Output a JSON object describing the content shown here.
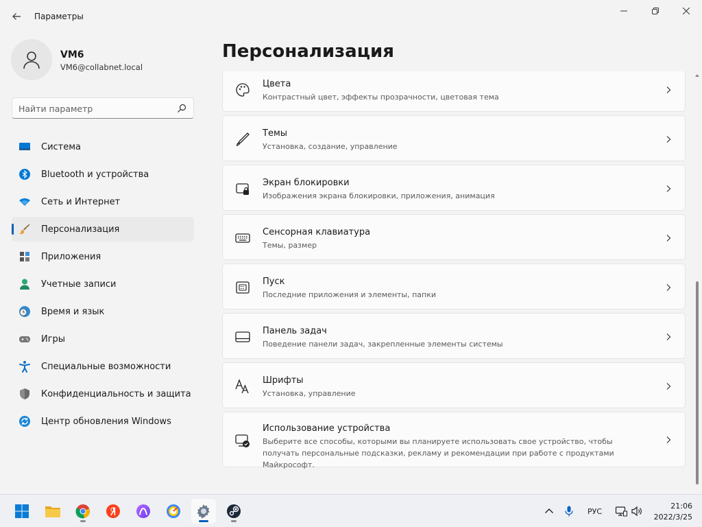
{
  "window": {
    "title": "Параметры",
    "back": "back-arrow-icon",
    "controls": [
      "minimize-icon",
      "maximize-icon",
      "close-icon"
    ]
  },
  "user": {
    "name": "VM6",
    "email": "VM6@collabnet.local"
  },
  "search": {
    "placeholder": "Найти параметр",
    "value": ""
  },
  "sidebar": {
    "items": [
      {
        "label": "Система",
        "icon": "display-icon",
        "active": false
      },
      {
        "label": "Bluetooth и устройства",
        "icon": "bluetooth-icon",
        "active": false
      },
      {
        "label": "Сеть и Интернет",
        "icon": "wifi-icon",
        "active": false
      },
      {
        "label": "Персонализация",
        "icon": "brush-icon",
        "active": true
      },
      {
        "label": "Приложения",
        "icon": "apps-icon",
        "active": false
      },
      {
        "label": "Учетные записи",
        "icon": "person-icon",
        "active": false
      },
      {
        "label": "Время и язык",
        "icon": "globe-clock-icon",
        "active": false
      },
      {
        "label": "Игры",
        "icon": "gamepad-icon",
        "active": false
      },
      {
        "label": "Специальные возможности",
        "icon": "accessibility-icon",
        "active": false
      },
      {
        "label": "Конфиденциальность и защита",
        "icon": "shield-icon",
        "active": false
      },
      {
        "label": "Центр обновления Windows",
        "icon": "update-icon",
        "active": false
      }
    ]
  },
  "page": {
    "title": "Персонализация"
  },
  "cards": [
    {
      "title": "Цвета",
      "subtitle": "Контрастный цвет, эффекты прозрачности, цветовая тема",
      "icon": "palette-icon"
    },
    {
      "title": "Темы",
      "subtitle": "Установка, создание, управление",
      "icon": "pen-icon"
    },
    {
      "title": "Экран блокировки",
      "subtitle": "Изображения экрана блокировки, приложения, анимация",
      "icon": "lock-screen-icon"
    },
    {
      "title": "Сенсорная клавиатура",
      "subtitle": "Темы, размер",
      "icon": "keyboard-icon"
    },
    {
      "title": "Пуск",
      "subtitle": "Последние приложения и элементы, папки",
      "icon": "start-menu-icon"
    },
    {
      "title": "Панель задач",
      "subtitle": "Поведение панели задач, закрепленные элементы системы",
      "icon": "taskbar-icon"
    },
    {
      "title": "Шрифты",
      "subtitle": "Установка, управление",
      "icon": "font-icon"
    },
    {
      "title": "Использование устройства",
      "subtitle": "Выберите все способы, которыми вы планируете использовать свое устройство, чтобы получать персональные подсказки, рекламу и рекомендации при работе с продуктами Майкрософт.",
      "icon": "device-usage-icon"
    }
  ],
  "taskbar": {
    "apps": [
      "windows-start-icon",
      "file-explorer-icon",
      "chrome-icon",
      "yandex-browser-icon",
      "alice-icon",
      "yandex-icon",
      "settings-gear-icon",
      "steam-icon"
    ],
    "active_app": "settings-gear-icon",
    "tray": {
      "language": "РУС",
      "icons": [
        "chevron-up-icon",
        "microphone-icon",
        "network-icon",
        "volume-icon"
      ]
    },
    "clock": {
      "time": "21:06",
      "date": "2022/3/25"
    }
  },
  "colors": {
    "accent": "#005fb8",
    "background": "#f3f3f3",
    "card": "#fbfbfb"
  }
}
